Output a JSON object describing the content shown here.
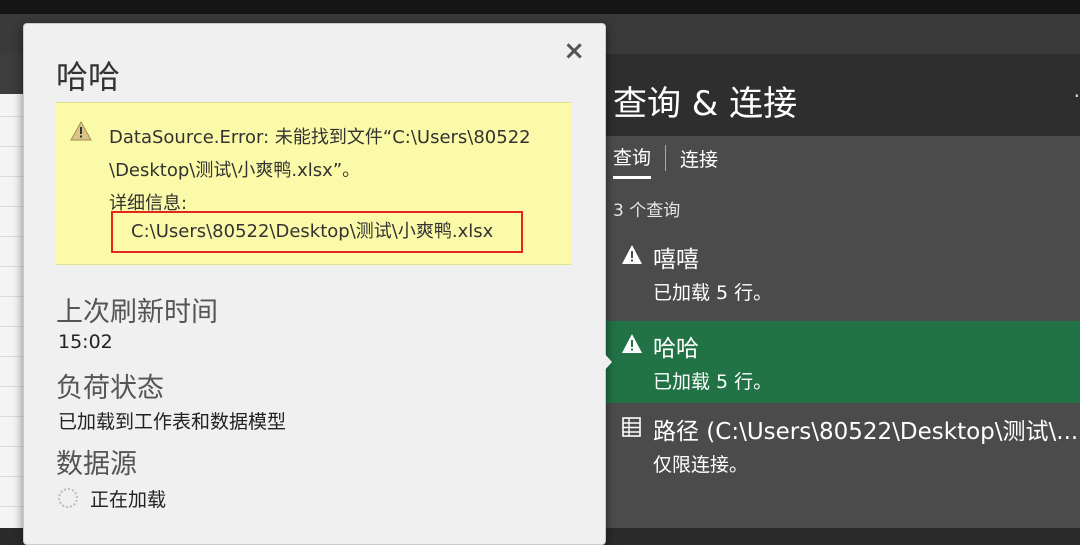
{
  "flyout": {
    "title": "哈哈",
    "close_glyph": "×",
    "error": {
      "line1": "DataSource.Error: 未能找到文件“C:\\Users\\80522",
      "line2": "\\Desktop\\测试\\小爽鸭.xlsx”。",
      "details_label": "详细信息:",
      "path": "C:\\Users\\80522\\Desktop\\测试\\小爽鸭.xlsx",
      "highlight_color": "#e5261f",
      "background_color": "#fafaa8"
    },
    "last_refresh": {
      "label": "上次刷新时间",
      "value": "15:02"
    },
    "load_status": {
      "label": "负荷状态",
      "value": "已加载到工作表和数据模型"
    },
    "data_source": {
      "label": "数据源",
      "value": "正在加载",
      "icon": "loading-spinner-icon"
    }
  },
  "pane": {
    "title": "查询 & 连接",
    "collapse_glyph": "·",
    "tabs": [
      {
        "label": "查询",
        "active": true
      },
      {
        "label": "连接",
        "active": false
      }
    ],
    "count_text": "3 个查询",
    "queries": [
      {
        "name": "嘻嘻",
        "status": "已加载 5 行。",
        "icon": "warning-icon",
        "selected": false
      },
      {
        "name": "哈哈",
        "status": "已加载 5 行。",
        "icon": "warning-icon",
        "selected": true
      },
      {
        "name": "路径 (C:\\Users\\80522\\Desktop\\测试\\...",
        "status": "仅限连接。",
        "icon": "table-icon",
        "selected": false
      }
    ],
    "selected_color": "#217346"
  }
}
